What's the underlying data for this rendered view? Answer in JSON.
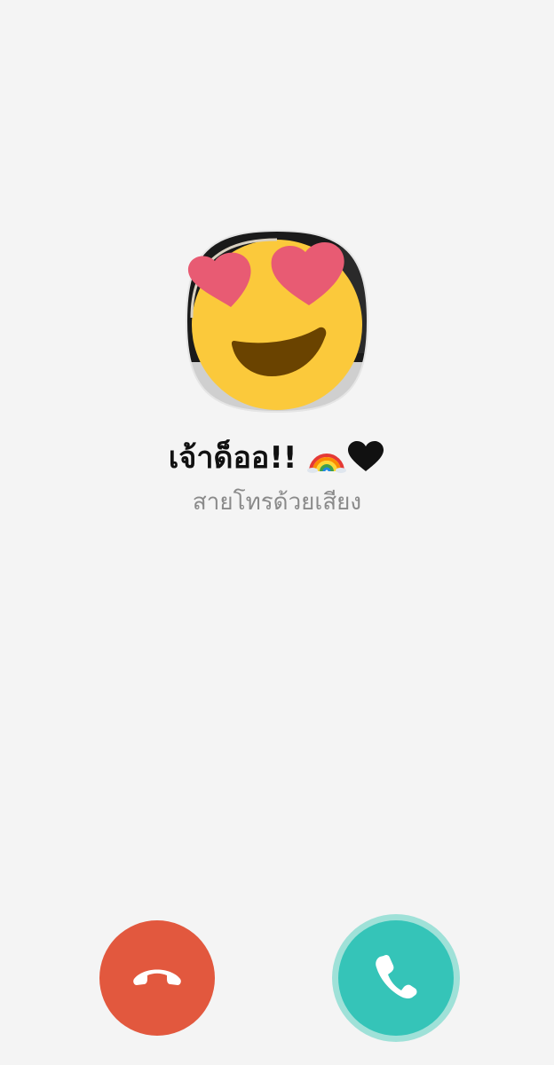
{
  "caller": {
    "name": "เจ้าด็ออ!! ",
    "name_emojis": [
      "rainbow-icon",
      "black-heart-icon"
    ],
    "call_type": "สายโทรด้วยเสียง",
    "avatar": "heart-eyes-emoji-avatar"
  },
  "actions": {
    "decline_icon": "hang-up-phone-icon",
    "accept_icon": "phone-icon"
  },
  "colors": {
    "background": "#f4f4f4",
    "decline": "#e2583e",
    "accept": "#35c4b8",
    "accept_ring": "#9fe1d8",
    "subtitle": "#8a8a8a"
  }
}
